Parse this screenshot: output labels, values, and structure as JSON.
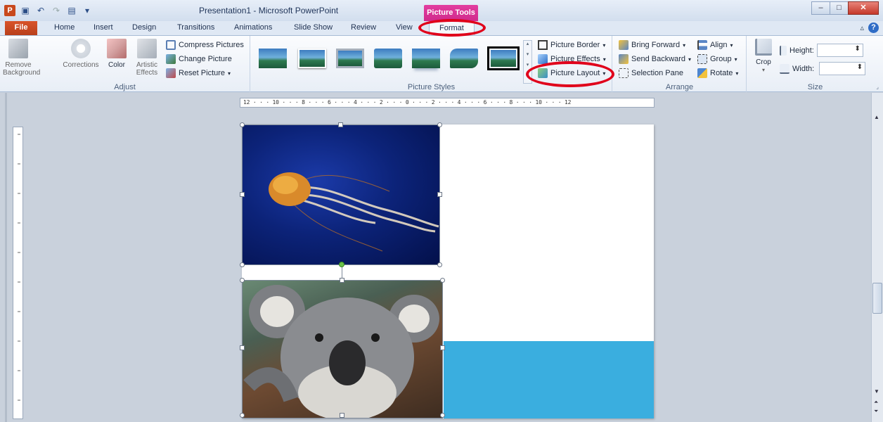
{
  "window": {
    "app_icon": "P",
    "title": "Presentation1 - Microsoft PowerPoint",
    "context_tab": "Picture Tools",
    "quick_access": [
      "save-icon",
      "undo-icon",
      "redo-icon",
      "layout-icon",
      "customize-icon"
    ],
    "controls": {
      "minimize": "–",
      "maximize": "□",
      "close": "✕"
    }
  },
  "tabs": {
    "file": "File",
    "items": [
      "Home",
      "Insert",
      "Design",
      "Transitions",
      "Animations",
      "Slide Show",
      "Review",
      "View",
      "Format"
    ],
    "active": "Format",
    "right_collapse": "▵",
    "help": "?"
  },
  "ribbon": {
    "adjust": {
      "label": "Adjust",
      "remove_background": "Remove Background",
      "corrections": "Corrections",
      "color": "Color",
      "artistic_effects": "Artistic Effects",
      "compress": "Compress Pictures",
      "change": "Change Picture",
      "reset": "Reset Picture"
    },
    "picture_styles": {
      "label": "Picture Styles",
      "border": "Picture Border",
      "effects": "Picture Effects",
      "layout": "Picture Layout",
      "thumb_count": 7,
      "selected_index": 6
    },
    "arrange": {
      "label": "Arrange",
      "bring_forward": "Bring Forward",
      "send_backward": "Send Backward",
      "selection_pane": "Selection Pane",
      "align": "Align",
      "group": "Group",
      "rotate": "Rotate"
    },
    "size": {
      "label": "Size",
      "crop": "Crop",
      "height_label": "Height:",
      "width_label": "Width:",
      "height_value": "",
      "width_value": ""
    }
  },
  "ruler": {
    "horizontal": "12 · · · 10 · · · 8 · · · 6 · · · 4 · · · 2 · · · 0 · · · 2 · · · 4 · · · 6 · · · 8 · · · 10 · · · 12"
  },
  "colors": {
    "accent_pink": "#d83a98",
    "file_tab": "#c54a21",
    "slide_blue": "#3aaedf",
    "annotation_red": "#e0001a"
  },
  "annotations": [
    "Format",
    "Picture Layout"
  ]
}
